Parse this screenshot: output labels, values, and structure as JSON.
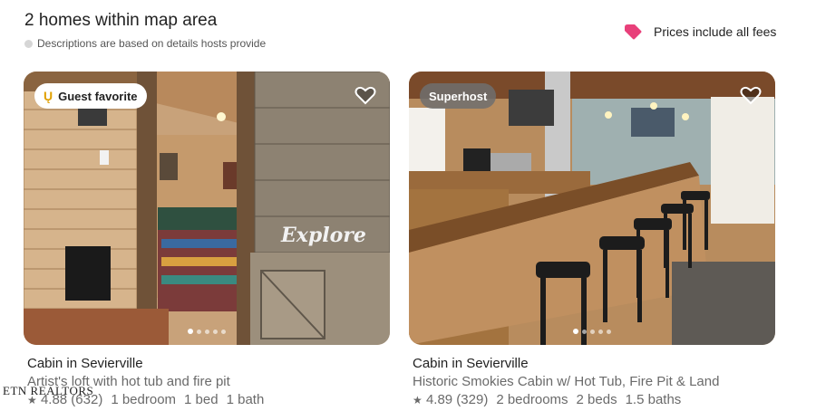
{
  "header": {
    "title": "2 homes within map area",
    "subtitle": "Descriptions are based on details hosts provide",
    "fees_label": "Prices include all fees"
  },
  "listings": [
    {
      "badge": "Guest favorite",
      "badge_type": "guest-favorite",
      "photo_overlay_text": "Explore",
      "title": "Cabin in Sevierville",
      "description": "Artist's loft with hot tub and fire pit",
      "rating": "4.88 (632)",
      "bedrooms": "1 bedroom",
      "beds": "1 bed",
      "baths": "1 bath",
      "photo_dots": 5,
      "active_dot": 0
    },
    {
      "badge": "Superhost",
      "badge_type": "superhost",
      "title": "Cabin in Sevierville",
      "description": "Historic Smokies Cabin w/ Hot Tub, Fire Pit & Land",
      "rating": "4.89 (329)",
      "bedrooms": "2 bedrooms",
      "beds": "2 beds",
      "baths": "1.5 baths",
      "photo_dots": 5,
      "active_dot": 0
    }
  ],
  "watermark": "ETN REALTORS",
  "colors": {
    "fees_tag": "#e8407a",
    "guest_favorite_laurel": "#e0a000",
    "wood_light": "#c9a27a",
    "wood_dark": "#7a5a3c"
  }
}
